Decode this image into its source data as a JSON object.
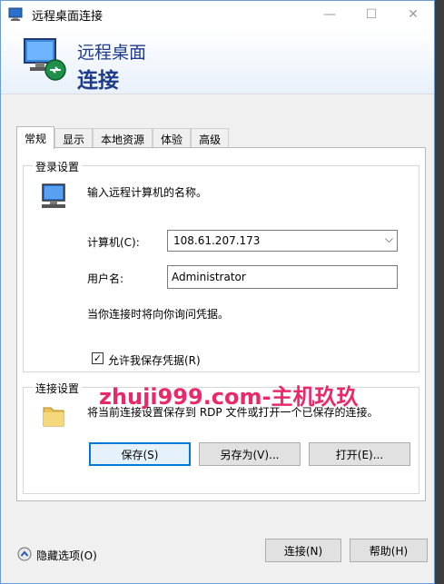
{
  "window": {
    "title": "远程桌面连接",
    "banner_line1": "远程桌面",
    "banner_line2": "连接",
    "controls": {
      "minimize": "—",
      "maximize": "☐",
      "close": "✕"
    }
  },
  "tabs": [
    {
      "label": "常规",
      "active": true
    },
    {
      "label": "显示"
    },
    {
      "label": "本地资源"
    },
    {
      "label": "体验"
    },
    {
      "label": "高级"
    }
  ],
  "login": {
    "group_title": "登录设置",
    "prompt": "输入远程计算机的名称。",
    "computer_label": "计算机(C):",
    "computer_value": "108.61.207.173",
    "username_label": "用户名:",
    "username_value": "Administrator",
    "credential_note": "当你连接时将向你询问凭据。",
    "save_credentials_label": "允许我保存凭据(R)",
    "save_credentials_checked": true
  },
  "connection": {
    "group_title": "连接设置",
    "description": "将当前连接设置保存到 RDP 文件或打开一个已保存的连接。",
    "save_button": "保存(S)",
    "save_as_button": "另存为(V)...",
    "open_button": "打开(E)..."
  },
  "footer": {
    "hide_options": "隐藏选项(O)",
    "connect_button": "连接(N)",
    "help_button": "帮助(H)"
  },
  "watermark": "zhuji999.com-主机玖玖"
}
